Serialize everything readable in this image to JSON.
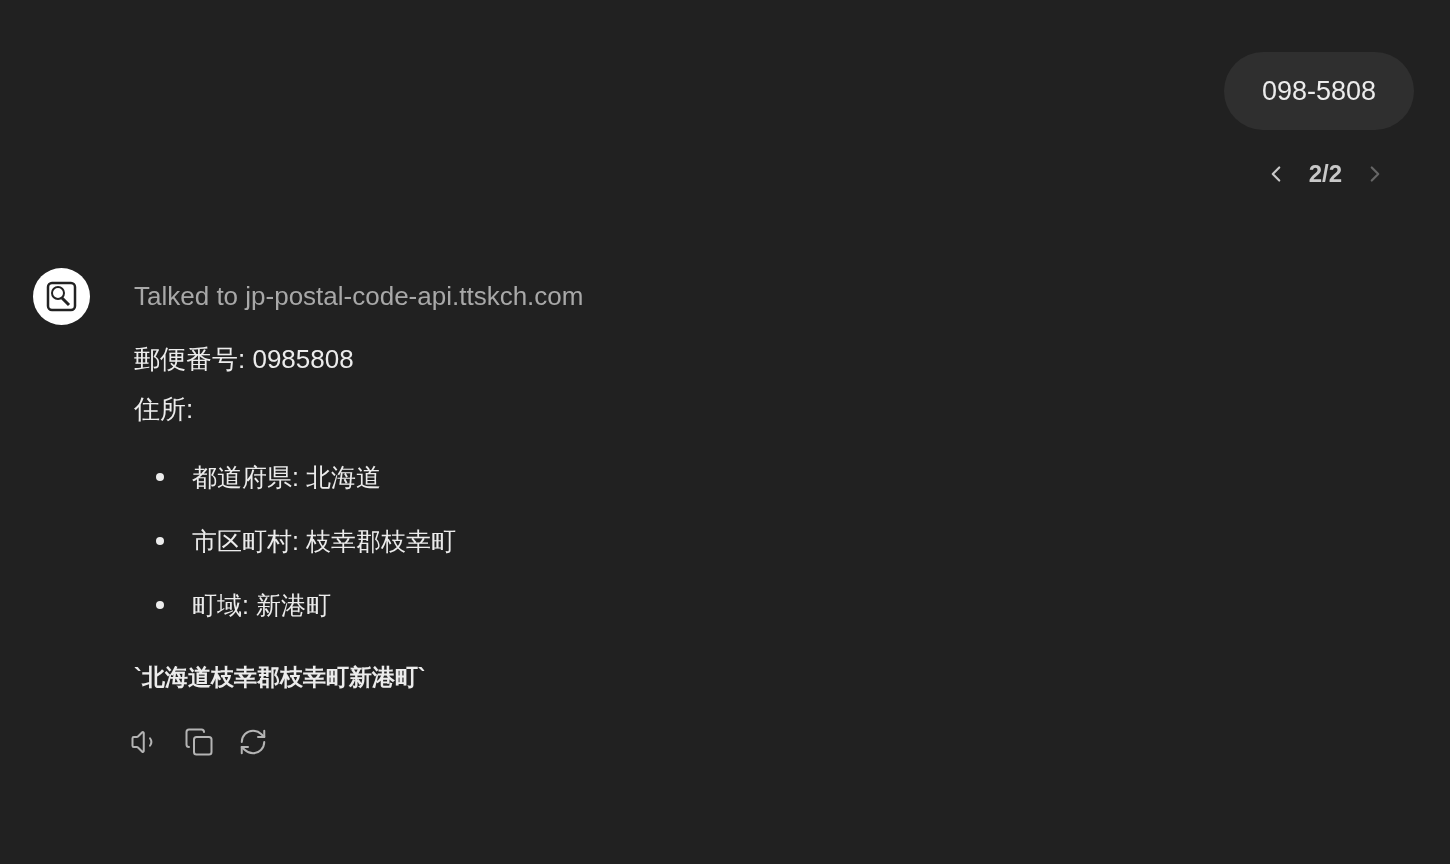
{
  "user_message": {
    "text": "098-5808"
  },
  "pager": {
    "label": "2/2",
    "prev": {
      "disabled": false
    },
    "next": {
      "disabled": true
    }
  },
  "assistant": {
    "tool_call": "Talked to jp-postal-code-api.ttskch.com",
    "lines": [
      "郵便番号: 0985808",
      "住所:"
    ],
    "bullets": [
      "都道府県: 北海道",
      "市区町村: 枝幸郡枝幸町",
      "町域: 新港町"
    ],
    "summary": "`北海道枝幸郡枝幸町新港町`",
    "actions": [
      {
        "kind": "speak"
      },
      {
        "kind": "copy"
      },
      {
        "kind": "regenerate"
      }
    ]
  }
}
